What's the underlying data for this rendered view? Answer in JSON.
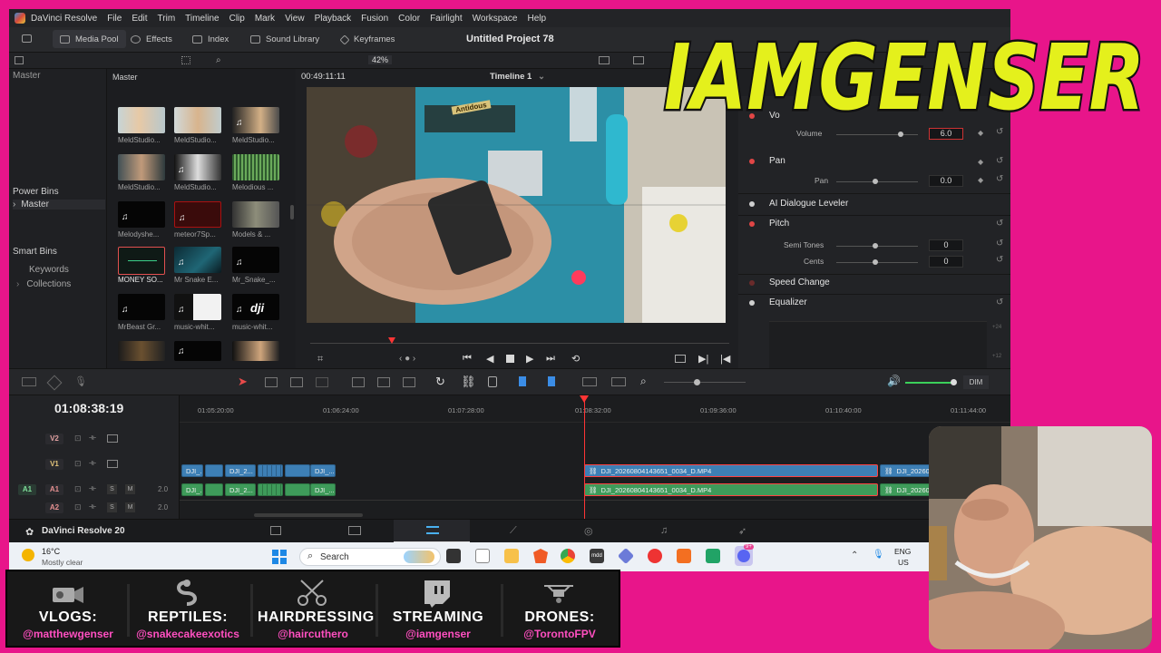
{
  "app": {
    "name": "DaVinci Resolve",
    "menu": [
      "File",
      "Edit",
      "Trim",
      "Timeline",
      "Clip",
      "Mark",
      "View",
      "Playback",
      "Fusion",
      "Color",
      "Fairlight",
      "Workspace",
      "Help"
    ],
    "project_title": "Untitled Project 78",
    "version_label": "DaVinci Resolve 20"
  },
  "toolbar": {
    "media_pool": "Media Pool",
    "effects": "Effects",
    "index": "Index",
    "sound_library": "Sound Library",
    "keyframes": "Keyframes"
  },
  "subbar": {
    "zoom": "42%"
  },
  "bins": {
    "master_top": "Master",
    "power_bins": "Power Bins",
    "power_master": "Master",
    "smart_bins": "Smart Bins",
    "keywords": "Keywords",
    "collections": "Collections"
  },
  "media_pool": {
    "header": "Master",
    "clips": [
      {
        "label": "MeldStudio..."
      },
      {
        "label": "MeldStudio..."
      },
      {
        "label": "MeldStudio..."
      },
      {
        "label": "MeldStudio..."
      },
      {
        "label": "MeldStudio..."
      },
      {
        "label": "Melodious ..."
      },
      {
        "label": "Melodyshe..."
      },
      {
        "label": "meteor7Sp..."
      },
      {
        "label": "Models & ..."
      },
      {
        "label": "MONEY SO..."
      },
      {
        "label": "Mr Snake E..."
      },
      {
        "label": "Mr_Snake_..."
      },
      {
        "label": "MrBeast Gr..."
      },
      {
        "label": "music-whit..."
      },
      {
        "label": "music-whit..."
      },
      {
        "label": ""
      },
      {
        "label": ""
      },
      {
        "label": ""
      }
    ],
    "dji_logo": "dji"
  },
  "viewer": {
    "timecode": "00:49:11:11",
    "timeline_name": "Timeline 1",
    "scene_text": "Antidous"
  },
  "inspector": {
    "volume_section": "Vo",
    "volume_label": "Volume",
    "volume_value": "6.0",
    "pan_section": "Pan",
    "pan_label": "Pan",
    "pan_value": "0.0",
    "dialogue_leveler": "AI Dialogue Leveler",
    "pitch_section": "Pitch",
    "semi_tones_label": "Semi Tones",
    "semi_tones_value": "0",
    "cents_label": "Cents",
    "cents_value": "0",
    "speed_change": "Speed Change",
    "equalizer": "Equalizer",
    "eq_scale_top": "+24",
    "eq_scale_mid": "+12"
  },
  "timeline": {
    "timecode": "01:08:38:19",
    "dim_label": "DIM",
    "ruler": [
      "01:05:20:00",
      "01:06:24:00",
      "01:07:28:00",
      "01:08:32:00",
      "01:09:36:00",
      "01:10:40:00",
      "01:11:44:00"
    ],
    "tracks": {
      "v2": "V2",
      "v1": "V1",
      "a1_dest": "A1",
      "a1": "A1",
      "a2": "A2",
      "a1_level": "2.0",
      "a2_level": "2.0",
      "s": "S",
      "m": "M"
    },
    "clips": {
      "v_small_1": "DJI_...",
      "v_small_2": "DJI_2...",
      "v_small_3": "DJI_...",
      "a_small_1": "DJI_...",
      "a_small_2": "DJI_2...",
      "a_small_3": "DJI_...",
      "v_main": "DJI_20260804143651_0034_D.MP4",
      "a_main": "DJI_20260804143651_0034_D.MP4",
      "v_next": "DJI_20260",
      "a_next": "DJI_20260"
    }
  },
  "taskbar": {
    "temp": "16°C",
    "weather": "Mostly clear",
    "search_label": "Search",
    "lang": "ENG",
    "region": "US",
    "badge": "9+",
    "mdd": "mdd"
  },
  "banner": {
    "items": [
      {
        "title": "VLOGS:",
        "handle": "@matthewgenser"
      },
      {
        "title": "REPTILES:",
        "handle": "@snakecakeexotics"
      },
      {
        "title": "HAIRDRESSING",
        "handle": "@haircuthero"
      },
      {
        "title": "STREAMING",
        "handle": "@iamgenser"
      },
      {
        "title": "DRONES:",
        "handle": "@TorontoFPV"
      }
    ]
  },
  "overlay_logo": "IAMGENSER",
  "colors": {
    "background": "#e8158a",
    "logo_fill": "#e4f01c",
    "handle": "#ff4fc0",
    "playhead": "#ff3535",
    "video_clip": "#3d7fb5",
    "audio_clip": "#3e9b5a"
  }
}
